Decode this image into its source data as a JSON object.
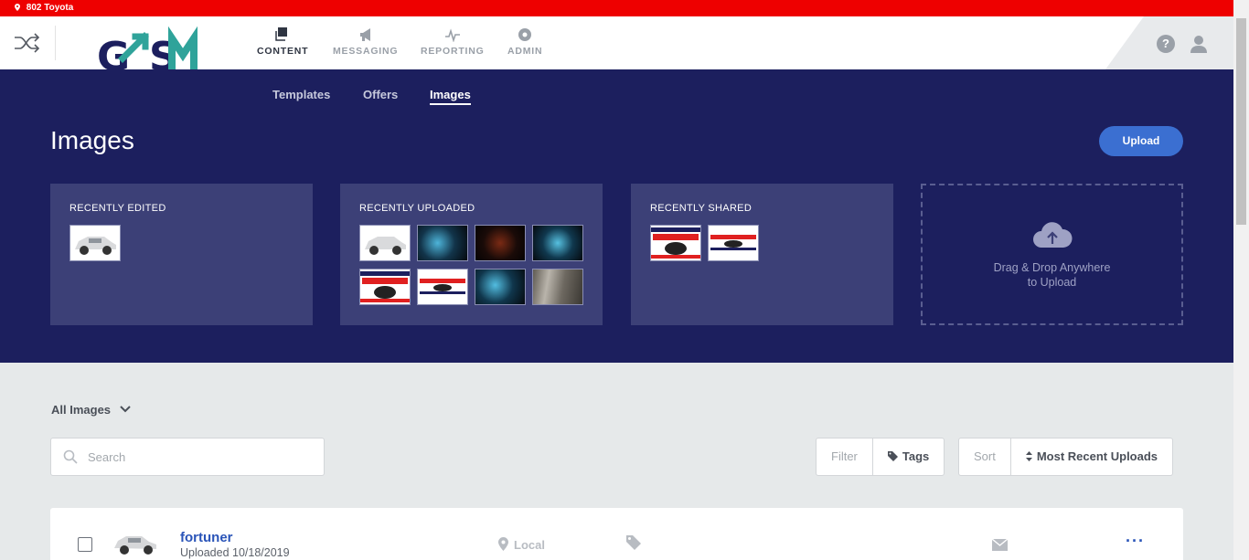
{
  "location_bar": {
    "label": "802 Toyota"
  },
  "nav": {
    "items": [
      {
        "label": "CONTENT",
        "icon": "content-icon",
        "active": true
      },
      {
        "label": "MESSAGING",
        "icon": "megaphone-icon",
        "active": false
      },
      {
        "label": "REPORTING",
        "icon": "pulse-icon",
        "active": false
      },
      {
        "label": "ADMIN",
        "icon": "gear-icon",
        "active": false
      }
    ]
  },
  "logo": {
    "text": "GSM"
  },
  "subnav": {
    "items": [
      {
        "label": "Templates"
      },
      {
        "label": "Offers"
      },
      {
        "label": "Images",
        "active": true
      }
    ]
  },
  "page": {
    "title": "Images",
    "upload_label": "Upload"
  },
  "panels": {
    "recently_edited": {
      "title": "RECENTLY EDITED"
    },
    "recently_uploaded": {
      "title": "RECENTLY UPLOADED"
    },
    "recently_shared": {
      "title": "RECENTLY SHARED"
    },
    "dropzone": {
      "line1": "Drag & Drop Anywhere",
      "line2": "to Upload"
    }
  },
  "filters": {
    "scope_label": "All Images",
    "search_placeholder": "Search",
    "filter_label": "Filter",
    "tags_label": "Tags",
    "sort_label": "Sort",
    "sort_value": "Most Recent Uploads"
  },
  "list": {
    "rows": [
      {
        "name": "fortuner",
        "date": "Uploaded 10/18/2019",
        "location": "Local"
      }
    ]
  },
  "colors": {
    "location_bar": "#ee0000",
    "hero": "#1c1f5e",
    "panel": "#3c4077",
    "accent": "#3b6fd1",
    "logo_teal": "#2fa39a",
    "logo_navy": "#1c1f5e"
  }
}
